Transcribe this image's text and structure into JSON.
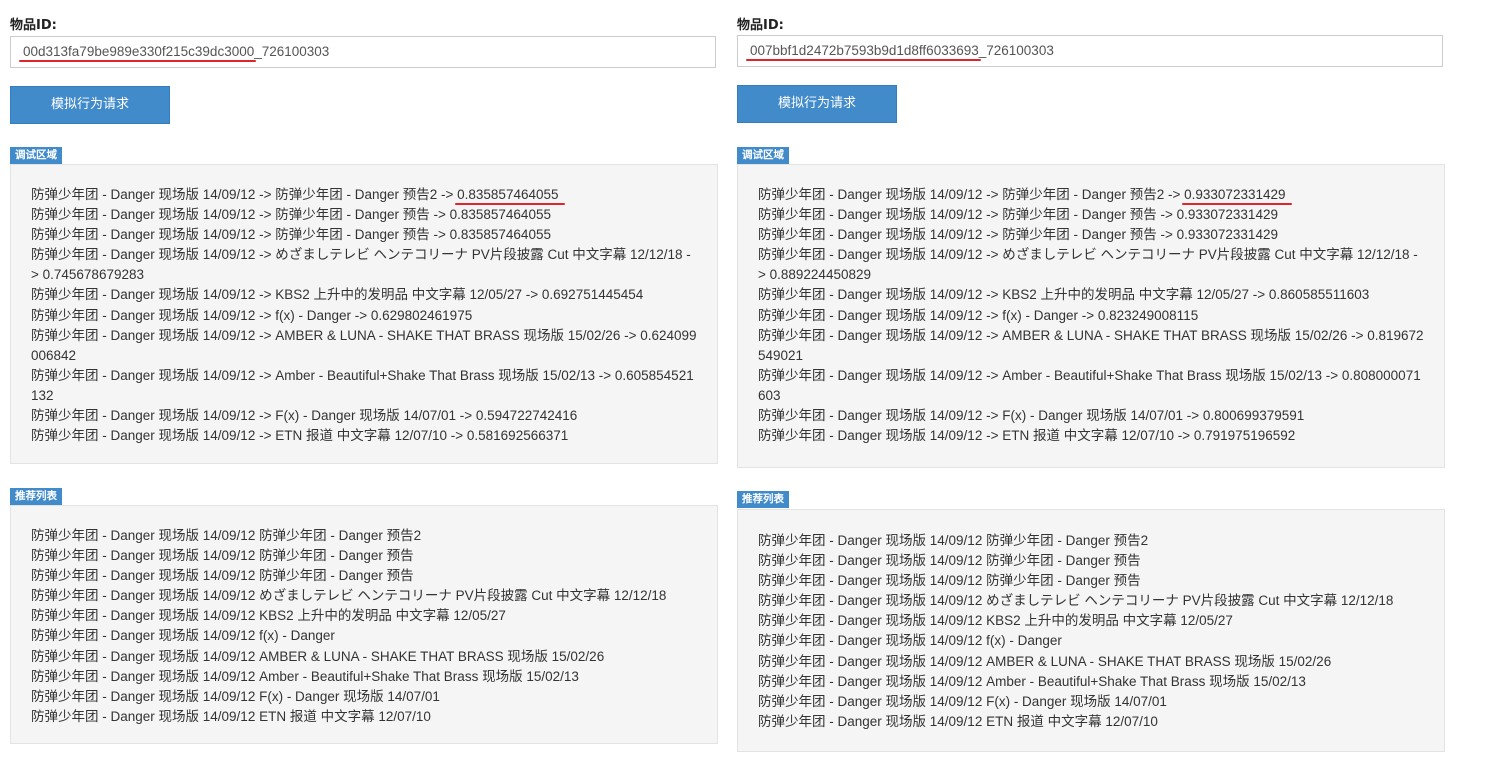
{
  "left": {
    "item_label": "物品ID:",
    "item_id_prefix": "00d313fa79be989e330f215c39dc3000",
    "item_id_suffix": "_726100303",
    "button_label": "模拟行为请求",
    "debug_label": "调试区域",
    "debug_lines": [
      {
        "text": "防弹少年团 - Danger 现场版 14/09/12 -> 防弹少年团 - Danger 预告2 ->",
        "score": "0.835857464055"
      },
      {
        "text": "防弹少年团 - Danger 现场版 14/09/12 -> 防弹少年团 - Danger 预告 -> 0.835857464055",
        "score": ""
      },
      {
        "text": "防弹少年团 - Danger 现场版 14/09/12 -> 防弹少年团 - Danger 预告 -> 0.835857464055",
        "score": ""
      },
      {
        "text": "防弹少年团 - Danger 现场版 14/09/12 -> めざましテレビ ヘンテコリーナ PV片段披露 Cut 中文字幕 12/12/18 -> 0.745678679283",
        "score": ""
      },
      {
        "text": "防弹少年团 - Danger 现场版 14/09/12 -> KBS2 上升中的发明品 中文字幕 12/05/27 -> 0.692751445454",
        "score": ""
      },
      {
        "text": "防弹少年团 - Danger 现场版 14/09/12 -> f(x) - Danger -> 0.629802461975",
        "score": ""
      },
      {
        "text": "防弹少年团 - Danger 现场版 14/09/12 -> AMBER & LUNA - SHAKE THAT BRASS 现场版 15/02/26 -> 0.624099006842",
        "score": ""
      },
      {
        "text": "防弹少年团 - Danger 现场版 14/09/12 -> Amber - Beautiful+Shake That Brass 现场版 15/02/13 -> 0.605854521132",
        "score": ""
      },
      {
        "text": "防弹少年团 - Danger 现场版 14/09/12 -> F(x) - Danger 现场版 14/07/01 -> 0.594722742416",
        "score": ""
      },
      {
        "text": "防弹少年团 - Danger 现场版 14/09/12 -> ETN 报道 中文字幕 12/07/10 -> 0.581692566371",
        "score": ""
      }
    ],
    "rec_label": "推荐列表",
    "rec_lines": [
      "防弹少年团 - Danger 现场版 14/09/12 防弹少年团 - Danger 预告2",
      "防弹少年团 - Danger 现场版 14/09/12 防弹少年团 - Danger 预告",
      "防弹少年团 - Danger 现场版 14/09/12 防弹少年团 - Danger 预告",
      "防弹少年团 - Danger 现场版 14/09/12 めざましテレビ ヘンテコリーナ PV片段披露 Cut 中文字幕 12/12/18",
      "防弹少年团 - Danger 现场版 14/09/12 KBS2 上升中的发明品 中文字幕 12/05/27",
      "防弹少年团 - Danger 现场版 14/09/12 f(x) - Danger",
      "防弹少年团 - Danger 现场版 14/09/12 AMBER & LUNA - SHAKE THAT BRASS 现场版 15/02/26",
      "防弹少年团 - Danger 现场版 14/09/12 Amber - Beautiful+Shake That Brass 现场版 15/02/13",
      "防弹少年团 - Danger 现场版 14/09/12 F(x) - Danger 现场版 14/07/01",
      "防弹少年团 - Danger 现场版 14/09/12 ETN 报道 中文字幕 12/07/10"
    ]
  },
  "right": {
    "item_label": "物品ID:",
    "item_id_prefix": "007bbf1d2472b7593b9d1d8ff6033693",
    "item_id_suffix": "_726100303",
    "button_label": "模拟行为请求",
    "debug_label": "调试区域",
    "debug_lines": [
      {
        "text": "防弹少年团 - Danger 现场版 14/09/12 -> 防弹少年团 - Danger 预告2 ->",
        "score": "0.933072331429"
      },
      {
        "text": "防弹少年团 - Danger 现场版 14/09/12 -> 防弹少年团 - Danger 预告 -> 0.933072331429",
        "score": ""
      },
      {
        "text": "防弹少年团 - Danger 现场版 14/09/12 -> 防弹少年团 - Danger 预告 -> 0.933072331429",
        "score": ""
      },
      {
        "text": "防弹少年团 - Danger 现场版 14/09/12 -> めざましテレビ ヘンテコリーナ PV片段披露 Cut 中文字幕 12/12/18 -> 0.889224450829",
        "score": ""
      },
      {
        "text": "防弹少年团 - Danger 现场版 14/09/12 -> KBS2 上升中的发明品 中文字幕 12/05/27 -> 0.860585511603",
        "score": ""
      },
      {
        "text": "防弹少年团 - Danger 现场版 14/09/12 -> f(x) - Danger -> 0.823249008115",
        "score": ""
      },
      {
        "text": "防弹少年团 - Danger 现场版 14/09/12 -> AMBER & LUNA - SHAKE THAT BRASS 现场版 15/02/26 -> 0.819672549021",
        "score": ""
      },
      {
        "text": "防弹少年团 - Danger 现场版 14/09/12 -> Amber - Beautiful+Shake That Brass 现场版 15/02/13 -> 0.808000071603",
        "score": ""
      },
      {
        "text": "防弹少年团 - Danger 现场版 14/09/12 -> F(x) - Danger 现场版 14/07/01 -> 0.800699379591",
        "score": ""
      },
      {
        "text": "防弹少年团 - Danger 现场版 14/09/12 -> ETN 报道 中文字幕 12/07/10 -> 0.791975196592",
        "score": ""
      }
    ],
    "rec_label": "推荐列表",
    "rec_lines": [
      "防弹少年团 - Danger 现场版 14/09/12 防弹少年团 - Danger 预告2",
      "防弹少年团 - Danger 现场版 14/09/12 防弹少年团 - Danger 预告",
      "防弹少年团 - Danger 现场版 14/09/12 防弹少年团 - Danger 预告",
      "防弹少年团 - Danger 现场版 14/09/12 めざましテレビ ヘンテコリーナ PV片段披露 Cut 中文字幕 12/12/18",
      "防弹少年团 - Danger 现场版 14/09/12 KBS2 上升中的发明品 中文字幕 12/05/27",
      "防弹少年团 - Danger 现场版 14/09/12 f(x) - Danger",
      "防弹少年团 - Danger 现场版 14/09/12 AMBER & LUNA - SHAKE THAT BRASS 现场版 15/02/26",
      "防弹少年团 - Danger 现场版 14/09/12 Amber - Beautiful+Shake That Brass 现场版 15/02/13",
      "防弹少年团 - Danger 现场版 14/09/12 F(x) - Danger 现场版 14/07/01",
      "防弹少年团 - Danger 现场版 14/09/12 ETN 报道 中文字幕 12/07/10"
    ]
  }
}
